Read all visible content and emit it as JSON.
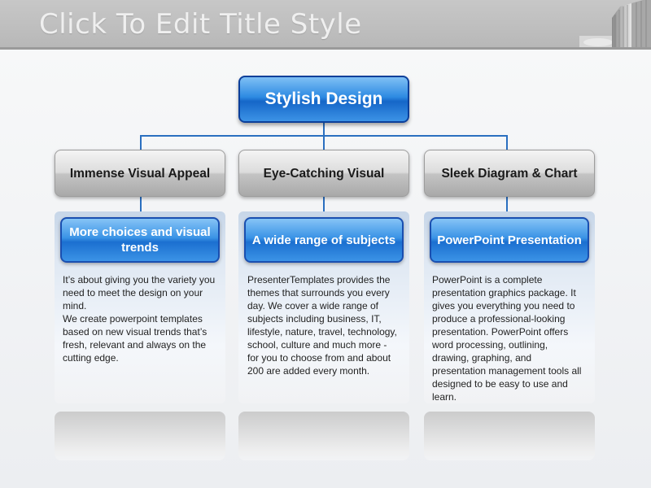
{
  "slide": {
    "title": "Click To Edit Title Style"
  },
  "diagram": {
    "root": {
      "label": "Stylish Design"
    },
    "columns": [
      {
        "header": "Immense Visual Appeal",
        "subheader": "More choices and visual trends",
        "body": "It’s about giving you the variety you need to meet the design on your mind.\nWe create powerpoint templates based on new visual trends that’s fresh, relevant and always on the cutting edge."
      },
      {
        "header": "Eye-Catching Visual",
        "subheader": "A wide range of subjects",
        "body": "PresenterTemplates provides the themes that surrounds you every day. We cover a wide range of subjects including business, IT, lifestyle, nature, travel, technology, school, culture and much more - for you to choose from and about 200 are added every month."
      },
      {
        "header": "Sleek Diagram & Chart",
        "subheader": "PowerPoint Presentation",
        "body": "PowerPoint is a complete presentation graphics package. It gives you everything you need to produce a professional-looking presentation. PowerPoint offers word processing, outlining, drawing, graphing, and presentation management tools all designed to be easy to use and learn."
      }
    ]
  },
  "colors": {
    "accent_blue": "#1b6fd0",
    "connector": "#2a6fc0",
    "header_gray": "#c4c4c4"
  }
}
